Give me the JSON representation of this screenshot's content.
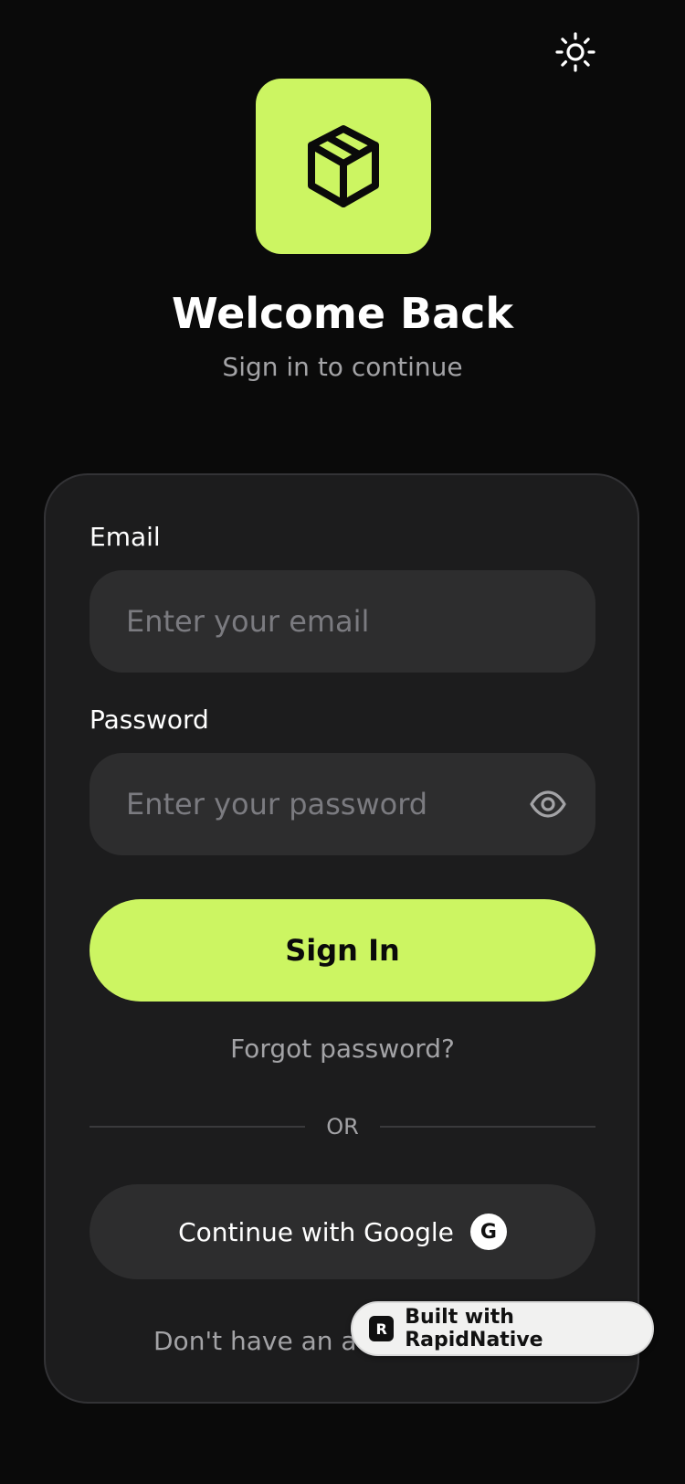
{
  "header": {
    "theme_toggle_icon": "sun-icon",
    "logo_icon": "package-box-icon",
    "title": "Welcome Back",
    "subtitle": "Sign in to continue"
  },
  "form": {
    "email_label": "Email",
    "email_placeholder": "Enter your email",
    "email_value": "",
    "password_label": "Password",
    "password_placeholder": "Enter your password",
    "password_value": "",
    "password_toggle_icon": "eye-icon",
    "signin_label": "Sign In",
    "forgot_label": "Forgot password?",
    "divider_label": "OR",
    "google_label": "Continue with Google",
    "google_icon_letter": "G",
    "signup_prompt_visible": "Don't have an acc"
  },
  "badge": {
    "icon_letter": "R",
    "label": "Built with RapidNative"
  },
  "colors": {
    "background": "#0a0a0a",
    "card": "#1c1c1d",
    "input": "#2d2d2e",
    "accent": "#ccf562",
    "muted_text": "#a3a3a6",
    "placeholder": "#7b7b80"
  }
}
